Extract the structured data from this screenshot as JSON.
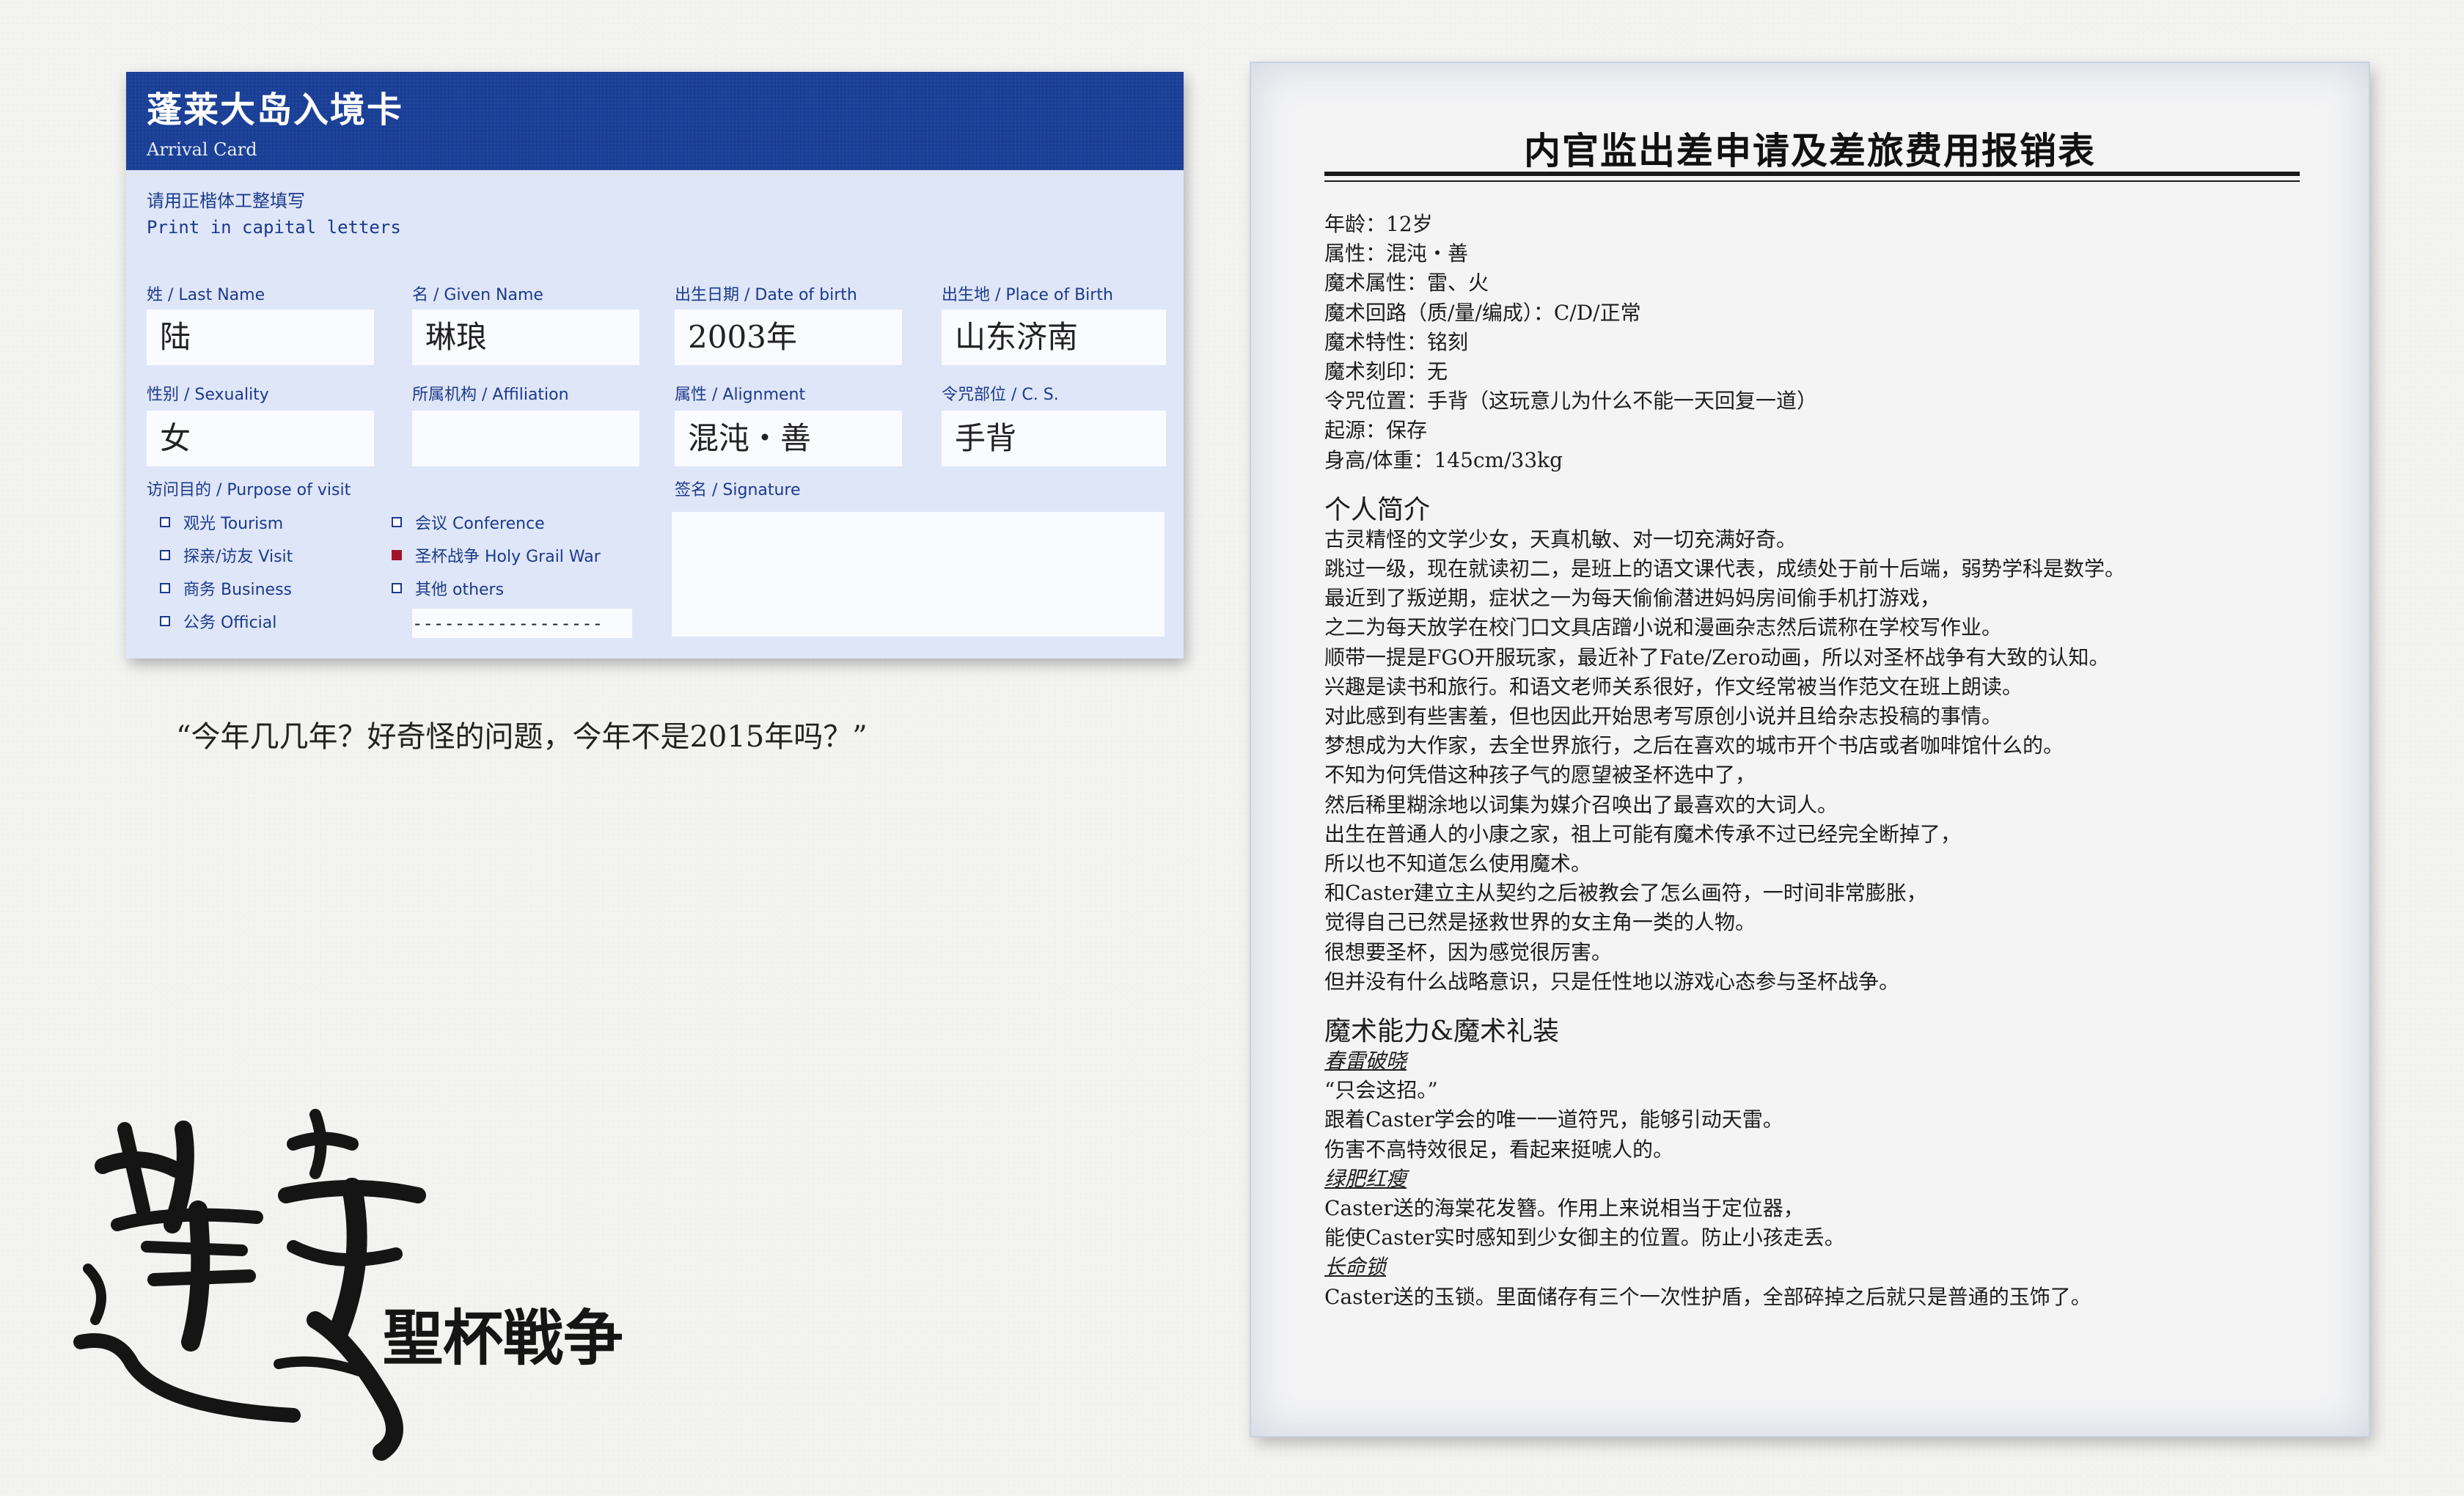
{
  "card": {
    "title": "蓬莱大岛入境卡",
    "subtitle": "Arrival Card",
    "instruction_cn": "请用正楷体工整填写",
    "instruction_en": "Print in capital letters",
    "fields": {
      "last_name_label": "姓 / Last Name",
      "last_name": "陆",
      "given_name_label": "名 / Given Name",
      "given_name": "琳琅",
      "dob_label": "出生日期 / Date of birth",
      "dob": "2003年",
      "pob_label": "出生地 / Place of Birth",
      "pob": "山东济南",
      "sex_label": "性别 / Sexuality",
      "sex": "女",
      "affiliation_label": "所属机构 / Affiliation",
      "affiliation": "",
      "alignment_label": "属性 / Alignment",
      "alignment": "混沌・善",
      "cs_label": "令咒部位 / C. S.",
      "cs": "手背",
      "purpose_label": "访问目的 / Purpose of visit",
      "signature_label": "签名 / Signature"
    },
    "purpose_options": [
      {
        "label": "观光 Tourism",
        "checked": false
      },
      {
        "label": "探亲/访友 Visit",
        "checked": false
      },
      {
        "label": "商务 Business",
        "checked": false
      },
      {
        "label": "公务 Official",
        "checked": false
      },
      {
        "label": "会议 Conference",
        "checked": false
      },
      {
        "label": "圣杯战争 Holy Grail War",
        "checked": true
      },
      {
        "label": "其他 others",
        "checked": false
      }
    ],
    "others_line": "------------------",
    "accent_color": "#1a3f96",
    "check_color": "#a0142b"
  },
  "quote": "“今年几几年？好奇怪的问题，今年不是2015年吗？”",
  "logo": {
    "calligraphy": "蓬莱",
    "subtitle": "聖杯戦争"
  },
  "sheet": {
    "title": "内官监出差申请及差旅费用报销表",
    "profile": [
      "年龄：12岁",
      "属性：混沌・善",
      "魔术属性：雷、火",
      "魔术回路（质/量/编成）：C/D/正常",
      "魔术特性：铭刻",
      "魔术刻印：无",
      "令咒位置：手背（这玩意儿为什么不能一天回复一道）",
      "起源：保存",
      "身高/体重：145cm/33kg"
    ],
    "bio_heading": "个人简介",
    "bio": [
      "古灵精怪的文学少女，天真机敏、对一切充满好奇。",
      "跳过一级，现在就读初二，是班上的语文课代表，成绩处于前十后端，弱势学科是数学。",
      "最近到了叛逆期，症状之一为每天偷偷潜进妈妈房间偷手机打游戏，",
      "之二为每天放学在校门口文具店蹭小说和漫画杂志然后谎称在学校写作业。",
      "顺带一提是FGO开服玩家，最近补了Fate/Zero动画，所以对圣杯战争有大致的认知。",
      "兴趣是读书和旅行。和语文老师关系很好，作文经常被当作范文在班上朗读。",
      "对此感到有些害羞，但也因此开始思考写原创小说并且给杂志投稿的事情。",
      "梦想成为大作家，去全世界旅行，之后在喜欢的城市开个书店或者咖啡馆什么的。",
      "不知为何凭借这种孩子气的愿望被圣杯选中了，",
      "然后稀里糊涂地以词集为媒介召唤出了最喜欢的大词人。",
      "出生在普通人的小康之家，祖上可能有魔术传承不过已经完全断掉了，",
      "所以也不知道怎么使用魔术。",
      "和Caster建立主从契约之后被教会了怎么画符，一时间非常膨胀，",
      "觉得自己已然是拯救世界的女主角一类的人物。",
      "很想要圣杯，因为感觉很厉害。",
      "但并没有什么战略意识，只是任性地以游戏心态参与圣杯战争。"
    ],
    "magic_heading": "魔术能力&魔术礼装",
    "skills": [
      {
        "name": "春雷破晓",
        "lines": [
          "“只会这招。”",
          "跟着Caster学会的唯一一道符咒，能够引动天雷。",
          "伤害不高特效很足，看起来挺唬人的。"
        ]
      },
      {
        "name": "绿肥红瘦",
        "lines": [
          "Caster送的海棠花发簪。作用上来说相当于定位器，",
          "能使Caster实时感知到少女御主的位置。防止小孩走丢。"
        ]
      },
      {
        "name": "长命锁",
        "lines": [
          "Caster送的玉锁。里面储存有三个一次性护盾，全部碎掉之后就只是普通的玉饰了。"
        ]
      }
    ]
  }
}
